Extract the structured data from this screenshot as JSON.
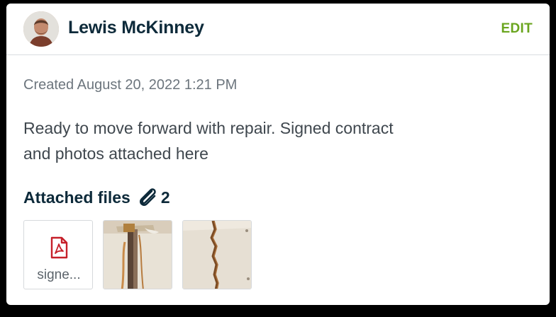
{
  "note": {
    "author": "Lewis McKinney",
    "edit_label": "EDIT",
    "created": "Created August 20, 2022 1:21 PM",
    "body_line1": "Ready to move forward with repair. Signed contract",
    "body_line2": "and photos attached here"
  },
  "attachments": {
    "title": "Attached files",
    "count": "2",
    "files": [
      {
        "name": "signe...",
        "type": "pdf"
      },
      {
        "type": "photo"
      },
      {
        "type": "photo"
      }
    ]
  },
  "colors": {
    "accent": "#6aa51e",
    "heading": "#0d2a3a",
    "pdf_red": "#c6202a"
  },
  "icons": [
    "avatar",
    "paperclip-icon",
    "pdf-icon"
  ]
}
